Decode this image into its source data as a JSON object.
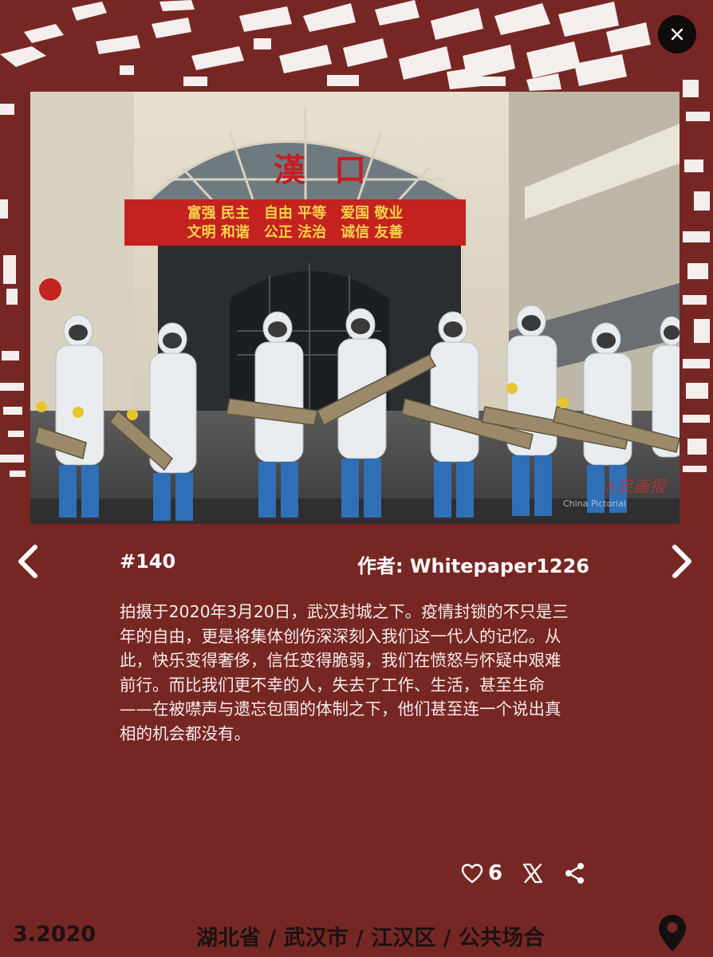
{
  "modal": {
    "close_icon": "close-icon"
  },
  "photo": {
    "station_sign": "漢口",
    "banner_line1": "富强 民主　自由 平等　爱国 敬业",
    "banner_line2": "文明 和谐　公正 法治　诚信 友善",
    "watermark": "人民画报",
    "watermark_sub": "China Pictorial"
  },
  "post": {
    "id": "#140",
    "author": "作者: Whitepaper1226",
    "description": "拍摄于2020年3月20日，武汉封城之下。疫情封锁的不只是三年的自由，更是将集体创伤深深刻入我们这一代人的记忆。从此，快乐变得奢侈，信任变得脆弱，我们在愤怒与怀疑中艰难前行。而比我们更不幸的人，失去了工作、生活，甚至生命——在被噤声与遗忘包围的体制之下，他们甚至连一个说出真相的机会都没有。"
  },
  "actions": {
    "likes": "6",
    "like_icon": "heart-icon",
    "x_icon": "x-logo-icon",
    "share_icon": "share-icon"
  },
  "footer": {
    "date": "3.2020",
    "location": "湖北省 / 武汉市 / 江汉区 / 公共场合",
    "pin_icon": "map-pin-icon"
  },
  "colors": {
    "background": "#762724",
    "map_blocks": "#ffffff",
    "footer_text": "#1c1212"
  }
}
